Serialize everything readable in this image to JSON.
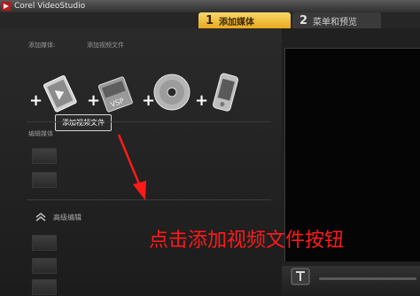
{
  "app": {
    "title": "Corel VideoStudio"
  },
  "steps": [
    {
      "num": "1",
      "label": "添加媒体"
    },
    {
      "num": "2",
      "label": "菜单和预览"
    }
  ],
  "panel": {
    "add_media_label": "添加媒体:",
    "add_video_file_header": "添加视频文件",
    "tooltip": "添加视频文件",
    "edit_section_label": "编辑媒体",
    "advanced_edit_label": "高级编辑"
  },
  "media_buttons": [
    {
      "icon": "add-video-file-icon"
    },
    {
      "icon": "add-vsp-project-icon"
    },
    {
      "icon": "add-disc-icon"
    },
    {
      "icon": "add-mobile-device-icon"
    }
  ],
  "annotation": {
    "text": "点击添加视频文件按钮",
    "color": "#ff1a1a"
  },
  "colors": {
    "active_tab": "#f0bd3a",
    "background": "#1a1a1a"
  }
}
